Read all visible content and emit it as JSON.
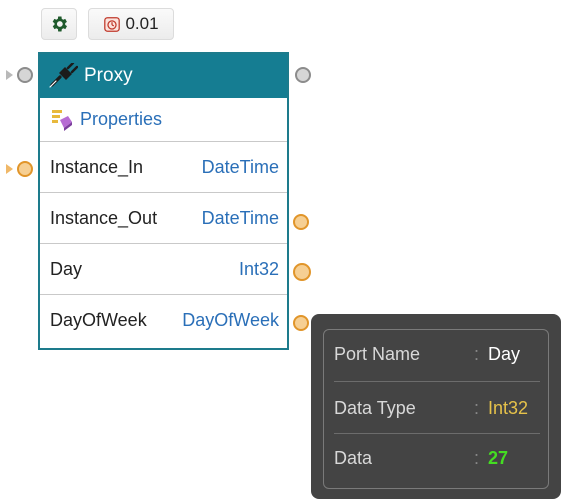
{
  "toolbar": {
    "timer_value": "0.01"
  },
  "node": {
    "title": "Proxy",
    "properties_label": "Properties",
    "ports": [
      {
        "name": "Instance_In",
        "type": "DateTime"
      },
      {
        "name": "Instance_Out",
        "type": "DateTime"
      },
      {
        "name": "Day",
        "type": "Int32"
      },
      {
        "name": "DayOfWeek",
        "type": "DayOfWeek"
      }
    ]
  },
  "tooltip": {
    "rows": [
      {
        "key": "Port Name",
        "sep": ":",
        "value": "Day"
      },
      {
        "key": "Data Type",
        "sep": ":",
        "value": "Int32"
      },
      {
        "key": "Data",
        "sep": ":",
        "value": "27"
      }
    ]
  },
  "colors": {
    "header_bg": "#157d92",
    "type_text": "#2a6fb8",
    "port_orange": "#f6cf93",
    "tooltip_bg": "#444444",
    "value_int32": "#e6c24a",
    "value_data": "#44dd22"
  },
  "icons": {
    "gear": "gear-icon",
    "timer": "stopwatch-icon",
    "proxy": "plug-icon",
    "properties": "properties-icon"
  }
}
